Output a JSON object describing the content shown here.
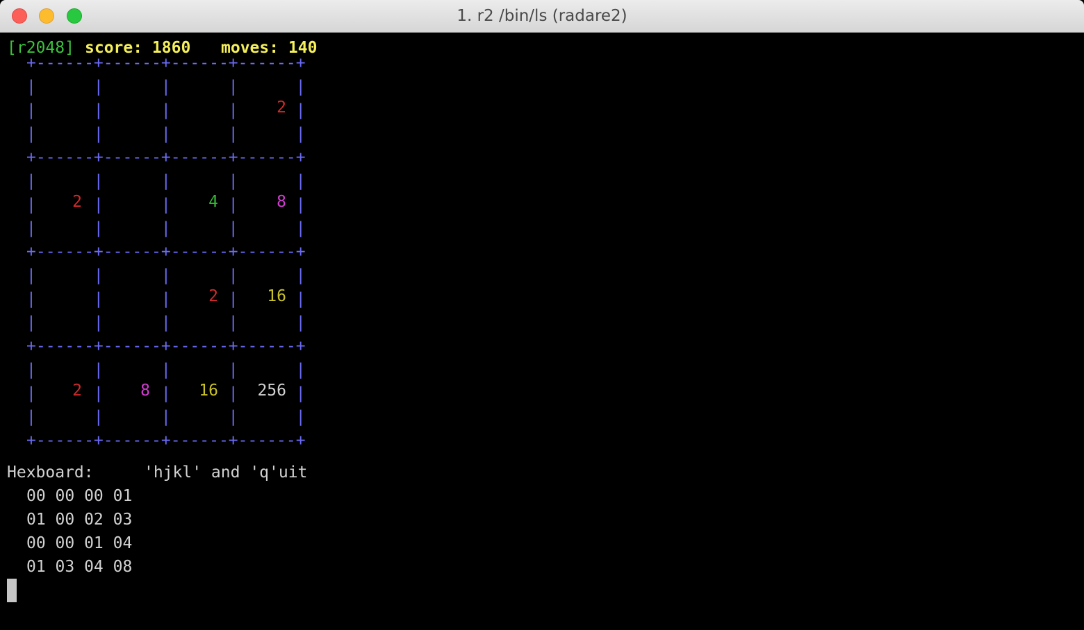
{
  "window": {
    "title": "1. r2 /bin/ls (radare2)"
  },
  "header": {
    "prompt": "[r2048]",
    "score": "score: 1860",
    "moves": "moves: 140"
  },
  "board": {
    "lines": [
      "+------+------+------+------+",
      "|      |      |      |      |",
      "|      |      |      |      |",
      "|      |      |      |      |",
      "+------+------+------+------+",
      "|      |      |      |      |",
      "|      |      |      |      |",
      "|      |      |      |      |",
      "+------+------+------+------+",
      "|      |      |      |      |",
      "|      |      |      |      |",
      "|      |      |      |      |",
      "+------+------+------+------+",
      "|      |      |      |      |",
      "|      |      |      |      |",
      "|      |      |      |      |",
      "+------+------+------+------+"
    ],
    "cells": [
      [
        "",
        "",
        "",
        "2"
      ],
      [
        "2",
        "",
        "4",
        "8"
      ],
      [
        "",
        "",
        "2",
        "16"
      ],
      [
        "2",
        "8",
        "16",
        "256"
      ]
    ]
  },
  "hexboard": {
    "label": "Hexboard:",
    "help": "'hjkl' and 'q'uit",
    "rows": [
      "00 00 00 01",
      "01 00 02 03",
      "00 00 01 04",
      "01 03 04 08"
    ]
  },
  "colors": {
    "prompt": "#3cc23c",
    "score": "#f4ef5a",
    "grid": "#6a6af4",
    "tile_2": "#d42a2a",
    "tile_4": "#32b832",
    "tile_8": "#d23cd2",
    "tile_16": "#c9c12a",
    "tile_256": "#d2d2d2"
  }
}
